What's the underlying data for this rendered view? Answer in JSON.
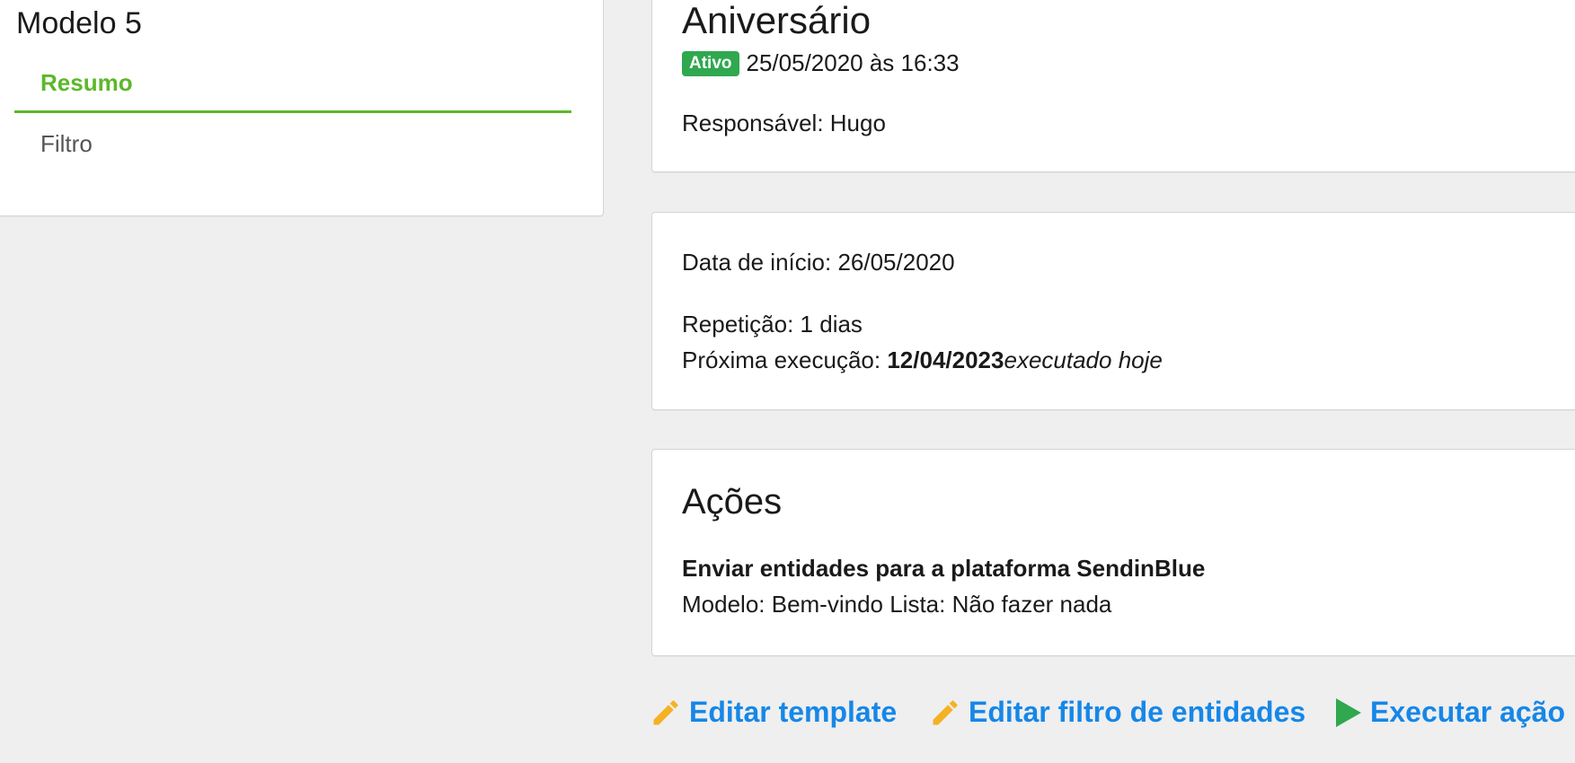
{
  "sidebar": {
    "title": "Modelo 5",
    "items": [
      {
        "label": "Resumo",
        "active": true
      },
      {
        "label": "Filtro",
        "active": false
      }
    ],
    "accent_color": "#5cb82a"
  },
  "header": {
    "title": "Aniversário",
    "status_badge": "Ativo",
    "created_at": "25/05/2020 às 16:33",
    "responsible_label": "Responsável:",
    "responsible_name": "Hugo"
  },
  "schedule": {
    "start_label": "Data de início:",
    "start_date": "26/05/2020",
    "repeat_label": "Repetição:",
    "repeat_value": "1 dias",
    "next_label": "Próxima execução:",
    "next_date": "12/04/2023",
    "next_note": "executado hoje"
  },
  "actions": {
    "heading": "Ações",
    "action_title": "Enviar entidades para a plataforma SendinBlue",
    "action_details": "Modelo: Bem-vindo Lista: Não fazer nada"
  },
  "links": {
    "edit_template": "Editar template",
    "edit_filter": "Editar filtro de entidades",
    "execute": "Executar ação",
    "link_color": "#1687e8",
    "pencil_color": "#f4b223",
    "play_color": "#2fa84f"
  }
}
